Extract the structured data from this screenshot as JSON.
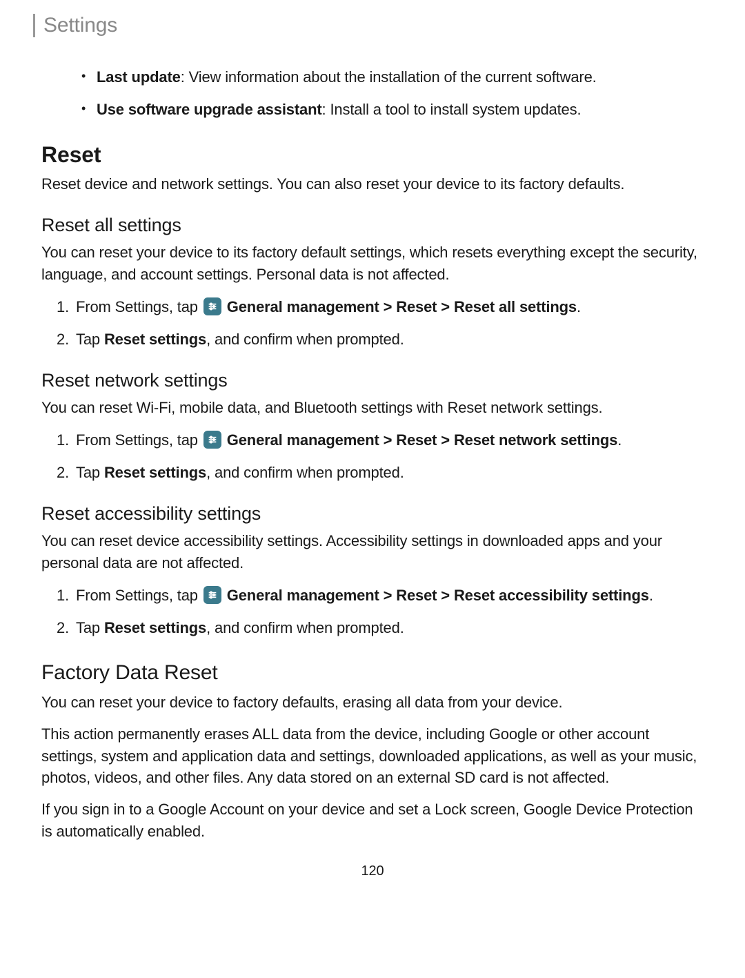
{
  "header": {
    "tab_label": "Settings"
  },
  "top_bullets": [
    {
      "bold": "Last update",
      "text": ": View information about the installation of the current software."
    },
    {
      "bold": "Use software upgrade assistant",
      "text": ": Install a tool to install system updates."
    }
  ],
  "reset": {
    "title": "Reset",
    "intro": "Reset device and network settings. You can also reset your device to its factory defaults."
  },
  "reset_all": {
    "title": "Reset all settings",
    "intro": "You can reset your device to its factory default settings, which resets everything except the security, language, and account settings. Personal data is not affected.",
    "step1_prefix": "From Settings, tap ",
    "step1_path": " General management > Reset > Reset all settings",
    "step1_suffix": ".",
    "step2_prefix": "Tap ",
    "step2_bold": "Reset settings",
    "step2_suffix": ", and confirm when prompted."
  },
  "reset_network": {
    "title": "Reset network settings",
    "intro": "You can reset Wi-Fi, mobile data, and Bluetooth settings with Reset network settings.",
    "step1_prefix": "From Settings, tap ",
    "step1_path": " General management > Reset > Reset network settings",
    "step1_suffix": ".",
    "step2_prefix": "Tap ",
    "step2_bold": "Reset settings",
    "step2_suffix": ", and confirm when prompted."
  },
  "reset_accessibility": {
    "title": "Reset accessibility settings",
    "intro": "You can reset device accessibility settings. Accessibility settings in downloaded apps and your personal data are not affected.",
    "step1_prefix": "From Settings, tap ",
    "step1_path": " General management > Reset > Reset accessibility settings",
    "step1_suffix": ".",
    "step2_prefix": "Tap ",
    "step2_bold": "Reset settings",
    "step2_suffix": ", and confirm when prompted."
  },
  "factory": {
    "title": "Factory Data Reset",
    "p1": "You can reset your device to factory defaults, erasing all data from your device.",
    "p2": "This action permanently erases ALL data from the device, including Google or other account settings, system and application data and settings, downloaded applications, as well as your music, photos, videos, and other files. Any data stored on an external SD card is not affected.",
    "p3": "If you sign in to a Google Account on your device and set a Lock screen, Google Device Protection is automatically enabled."
  },
  "page_number": "120"
}
